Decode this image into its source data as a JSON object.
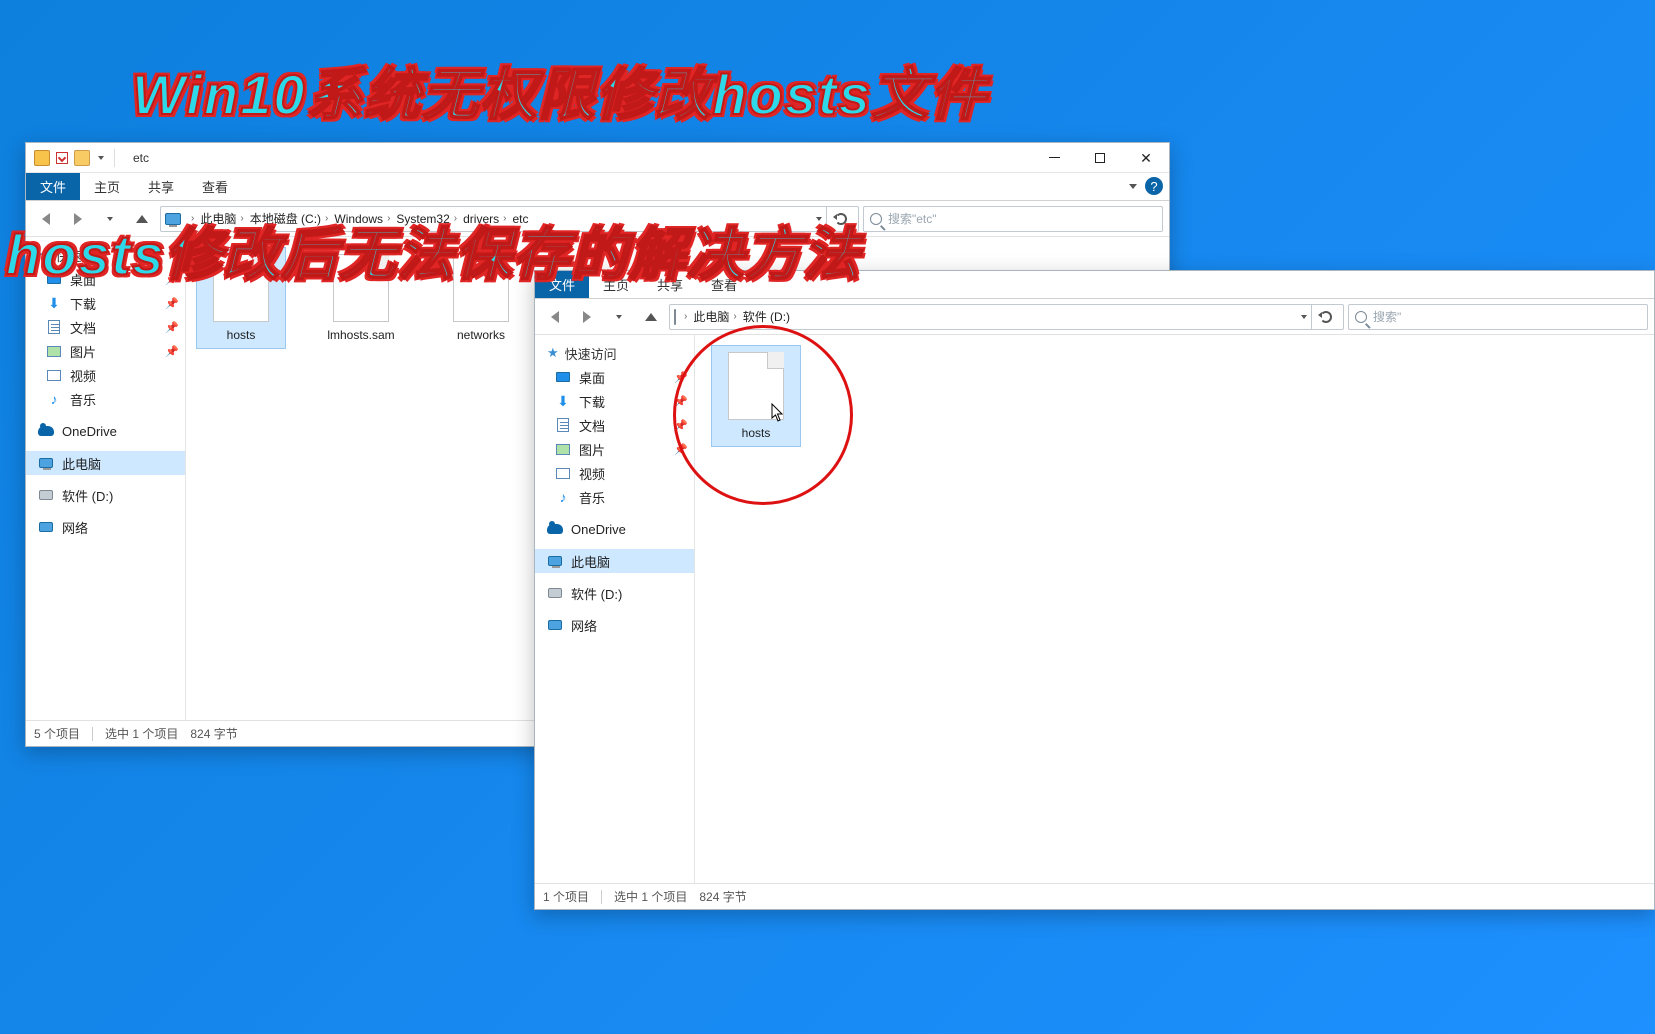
{
  "overlay": {
    "line1": "Win10系统无权限修改hosts文件",
    "line2": "hosts修改后无法保存的解决方法"
  },
  "window1": {
    "title": "etc",
    "tabs": {
      "file": "文件",
      "home": "主页",
      "share": "共享",
      "view": "查看"
    },
    "breadcrumb": [
      "此电脑",
      "本地磁盘 (C:)",
      "Windows",
      "System32",
      "drivers",
      "etc"
    ],
    "search_placeholder": "搜索\"etc\"",
    "nav": {
      "quick_access": "快速访问",
      "desktop": "桌面",
      "downloads": "下载",
      "documents": "文档",
      "pictures": "图片",
      "videos": "视频",
      "music": "音乐",
      "onedrive": "OneDrive",
      "this_pc": "此电脑",
      "software_d": "软件 (D:)",
      "network": "网络"
    },
    "files": [
      {
        "name": "hosts",
        "selected": true
      },
      {
        "name": "lmhosts.sam",
        "selected": false
      },
      {
        "name": "networks",
        "selected": false
      }
    ],
    "status": {
      "count": "5 个项目",
      "selection": "选中 1 个项目",
      "size": "824 字节"
    }
  },
  "window2": {
    "tabs": {
      "file": "文件",
      "home": "主页",
      "share": "共享",
      "view": "查看"
    },
    "breadcrumb": [
      "此电脑",
      "软件 (D:)"
    ],
    "search_placeholder": "搜索\"",
    "nav": {
      "quick_access": "快速访问",
      "desktop": "桌面",
      "downloads": "下载",
      "documents": "文档",
      "pictures": "图片",
      "videos": "视频",
      "music": "音乐",
      "onedrive": "OneDrive",
      "this_pc": "此电脑",
      "software_d": "软件 (D:)",
      "network": "网络"
    },
    "files": [
      {
        "name": "hosts",
        "selected": true
      }
    ],
    "status": {
      "count": "1 个项目",
      "selection": "选中 1 个项目",
      "size": "824 字节"
    }
  }
}
